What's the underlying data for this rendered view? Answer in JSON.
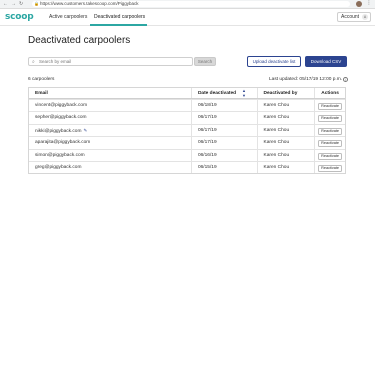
{
  "browser": {
    "url": "https://www.customers.takescoop.com/Piggyback",
    "back_glyph": "←",
    "forward_glyph": "→",
    "reload_glyph": "↻",
    "lock_glyph": "🔒",
    "menu_glyph": "⋮"
  },
  "header": {
    "logo": "scoop",
    "tabs": [
      {
        "label": "Active carpoolers",
        "active": false
      },
      {
        "label": "Deactivated carpoolers",
        "active": true
      }
    ],
    "account_label": "Account",
    "account_initial": "A"
  },
  "page": {
    "title": "Deactivated carpoolers",
    "search_placeholder": "Search by email",
    "search_button": "Search",
    "upload_button": "Upload deactivate list",
    "download_button": "Download CSV",
    "count_label": "6 carpoolers",
    "last_updated": "Last updated: 05/17/19 12:00 p.m.",
    "info_glyph": "i"
  },
  "table": {
    "headers": {
      "email": "Email",
      "date": "Date deactivated",
      "by": "Deactivated by",
      "actions": "Actions"
    },
    "action_label": "Reactivate",
    "rows": [
      {
        "email": "vincent@piggyback.com",
        "date": "06/18/19",
        "by": "Karen Chou",
        "edit": false
      },
      {
        "email": "sepher@piggyback.com",
        "date": "06/17/19",
        "by": "Karen Chou",
        "edit": false
      },
      {
        "email": "nikki@piggyback.com",
        "date": "06/17/19",
        "by": "Karen Chou",
        "edit": true
      },
      {
        "email": "aparajita@piggyback.com",
        "date": "06/17/19",
        "by": "Karen Chou",
        "edit": false
      },
      {
        "email": "simon@piggyback.com",
        "date": "06/16/19",
        "by": "Karen Chou",
        "edit": false
      },
      {
        "email": "greg@piggyback.com",
        "date": "06/15/19",
        "by": "Karen Chou",
        "edit": false
      }
    ]
  },
  "colors": {
    "brand": "#2ca7a3",
    "primary": "#2c4490"
  }
}
